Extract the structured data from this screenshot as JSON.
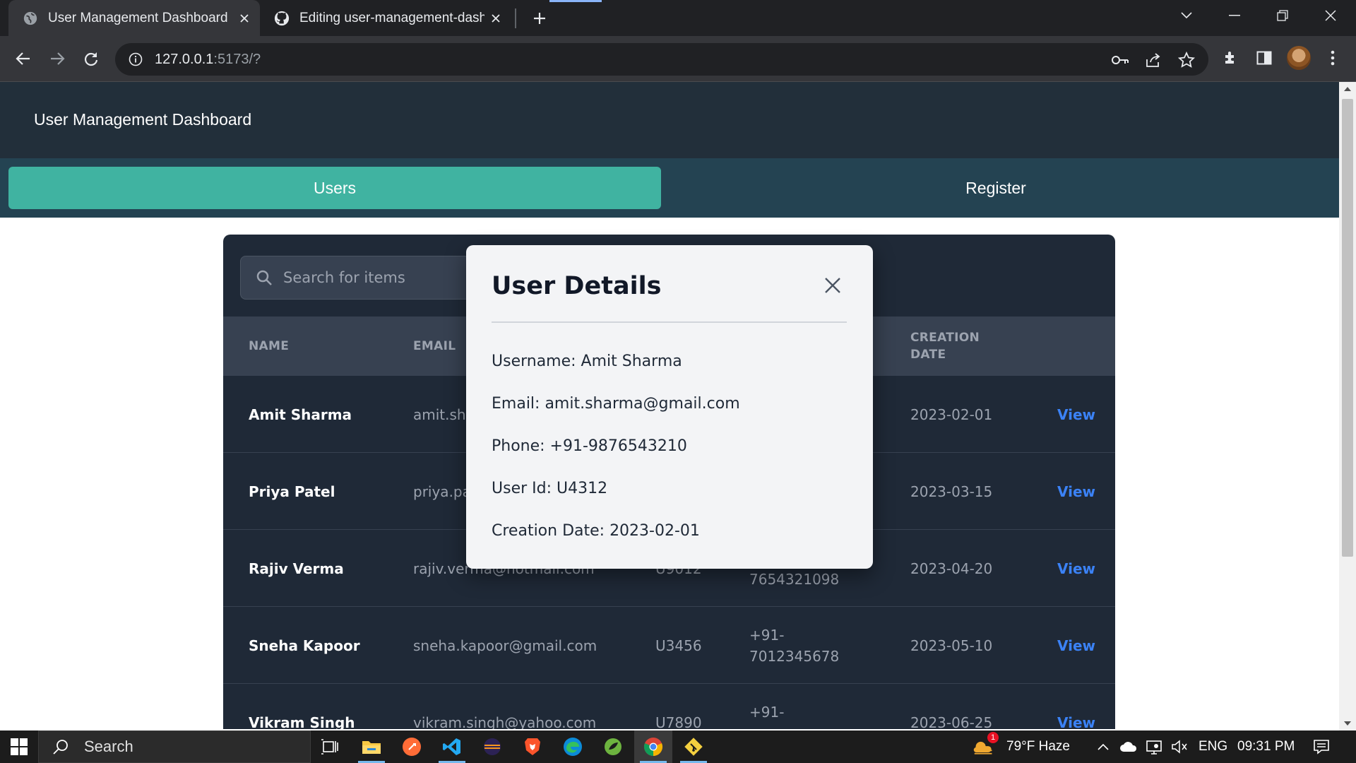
{
  "browser": {
    "tabs": [
      {
        "title": "User Management Dashboard",
        "active": true
      },
      {
        "title": "Editing user-management-dashboard",
        "active": false
      }
    ],
    "url_host": "127.0.0.1",
    "url_rest": ":5173/?"
  },
  "app": {
    "title": "User Management Dashboard",
    "nav": {
      "users": "Users",
      "register": "Register"
    },
    "search": {
      "placeholder": "Search for items"
    },
    "columns": {
      "name": "NAME",
      "email": "EMAIL",
      "creation_date_1": "CREATION",
      "creation_date_2": "DATE"
    },
    "rows": [
      {
        "name": "Amit Sharma",
        "email": "amit.sha",
        "user_id": "",
        "phone_1": "",
        "phone_2": "",
        "date": "2023-02-01",
        "action": "View"
      },
      {
        "name": "Priya Patel",
        "email": "priya.pa",
        "user_id": "",
        "phone_1": "",
        "phone_2": "",
        "date": "2023-03-15",
        "action": "View"
      },
      {
        "name": "Rajiv Verma",
        "email": "rajiv.verma@hotmail.com",
        "user_id": "U9012",
        "phone_1": "",
        "phone_2": "7654321098",
        "date": "2023-04-20",
        "action": "View"
      },
      {
        "name": "Sneha Kapoor",
        "email": "sneha.kapoor@gmail.com",
        "user_id": "U3456",
        "phone_1": "+91-",
        "phone_2": "7012345678",
        "date": "2023-05-10",
        "action": "View"
      },
      {
        "name": "Vikram Singh",
        "email": "vikram.singh@yahoo.com",
        "user_id": "U7890",
        "phone_1": "+91-",
        "phone_2": "",
        "date": "2023-06-25",
        "action": "View"
      }
    ]
  },
  "modal": {
    "title": "User Details",
    "username": "Username: Amit Sharma",
    "email": "Email: amit.sharma@gmail.com",
    "phone": "Phone: +91-9876543210",
    "user_id": "User Id: U4312",
    "creation_date": "Creation Date: 2023-02-01"
  },
  "taskbar": {
    "search_label": "Search",
    "weather": "79°F  Haze",
    "weather_badge": "1",
    "language": "ENG",
    "time": "09:31 PM"
  },
  "colors": {
    "header_bg": "#222f3a",
    "nav_bg": "#244352",
    "accent": "#40b3a1",
    "card_bg": "#1f2937",
    "link": "#3b82f6"
  },
  "icons": [
    "globe-icon",
    "github-icon",
    "close-icon",
    "plus-icon",
    "back-arrow-icon",
    "forward-arrow-icon",
    "reload-icon",
    "info-icon",
    "key-icon",
    "share-icon",
    "star-icon",
    "puzzle-icon",
    "sidepanel-icon",
    "menu-icon",
    "search-icon",
    "windows-icon",
    "task-view-icon",
    "folder-icon",
    "vscode-icon",
    "chrome-icon",
    "cloud-icon",
    "mute-icon",
    "notification-icon"
  ]
}
